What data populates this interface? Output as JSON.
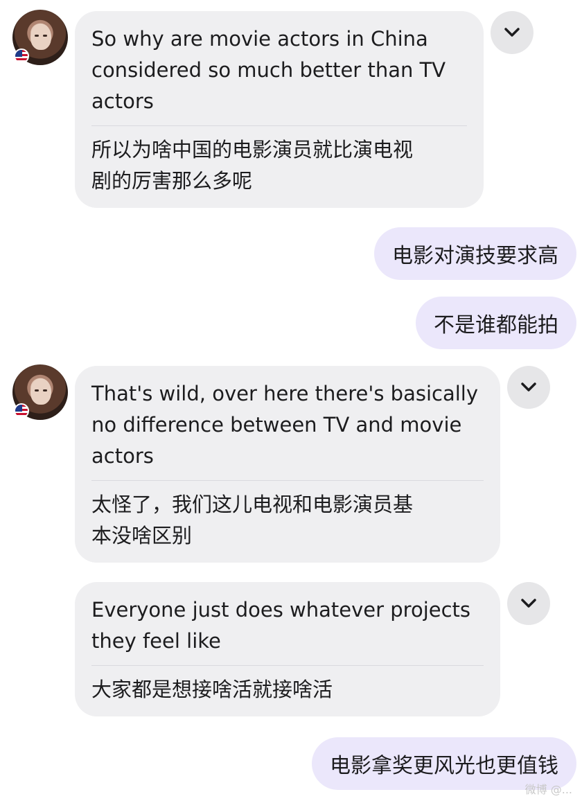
{
  "messages": [
    {
      "side": "received",
      "country_flag": "US",
      "text": "So why are movie actors in China\nconsidered so much better than TV\nactors",
      "translation": "所以为啥中国的电影演员就比演电视\n剧的厉害那么多呢",
      "menu_icon": "chevron-down-icon"
    },
    {
      "side": "sent",
      "text": "电影对演技要求高"
    },
    {
      "side": "sent",
      "text": "不是谁都能拍"
    },
    {
      "side": "received",
      "country_flag": "US",
      "text": "That's wild, over here there's basically\nno difference between TV and movie\nactors",
      "translation": "太怪了，我们这儿电视和电影演员基\n本没啥区别",
      "menu_icon": "chevron-down-icon"
    },
    {
      "side": "received",
      "text": "Everyone just does whatever projects\nthey feel like",
      "translation": "大家都是想接啥活就接啥活",
      "menu_icon": "chevron-down-icon"
    },
    {
      "side": "sent",
      "text": "电影拿奖更风光也更值钱"
    }
  ],
  "watermark": "微博 @..."
}
